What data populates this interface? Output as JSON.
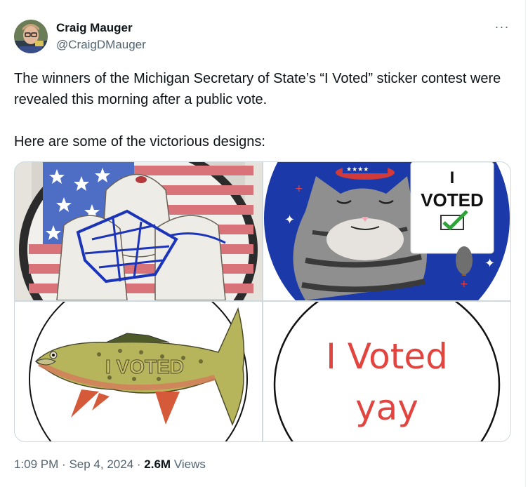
{
  "author": {
    "name": "Craig Mauger",
    "handle": "@CraigDMauger",
    "avatar_icon": "profile-photo"
  },
  "more_icon_glyph": "···",
  "tweet": {
    "paragraph1": "The winners of the Michigan Secretary of State’s “I Voted” sticker contest were revealed this morning after a public vote.",
    "paragraph2": "Here are some of the victorious designs:"
  },
  "media": {
    "images": [
      {
        "name": "sasquatch-flag-sticker"
      },
      {
        "name": "cat-voted-sign-sticker",
        "sign_line1": "I",
        "sign_line2": "VOTED"
      },
      {
        "name": "trout-sticker",
        "fish_text": "I VOTED"
      },
      {
        "name": "handwritten-sticker",
        "line1": "I Voted",
        "line2": "yay"
      }
    ]
  },
  "meta": {
    "time": "1:09 PM",
    "separator": "·",
    "date": "Sep 4, 2024",
    "views_count": "2.6M",
    "views_label": "Views"
  },
  "colors": {
    "text": "#0f1419",
    "secondary": "#536471",
    "border": "#cfd9de"
  }
}
